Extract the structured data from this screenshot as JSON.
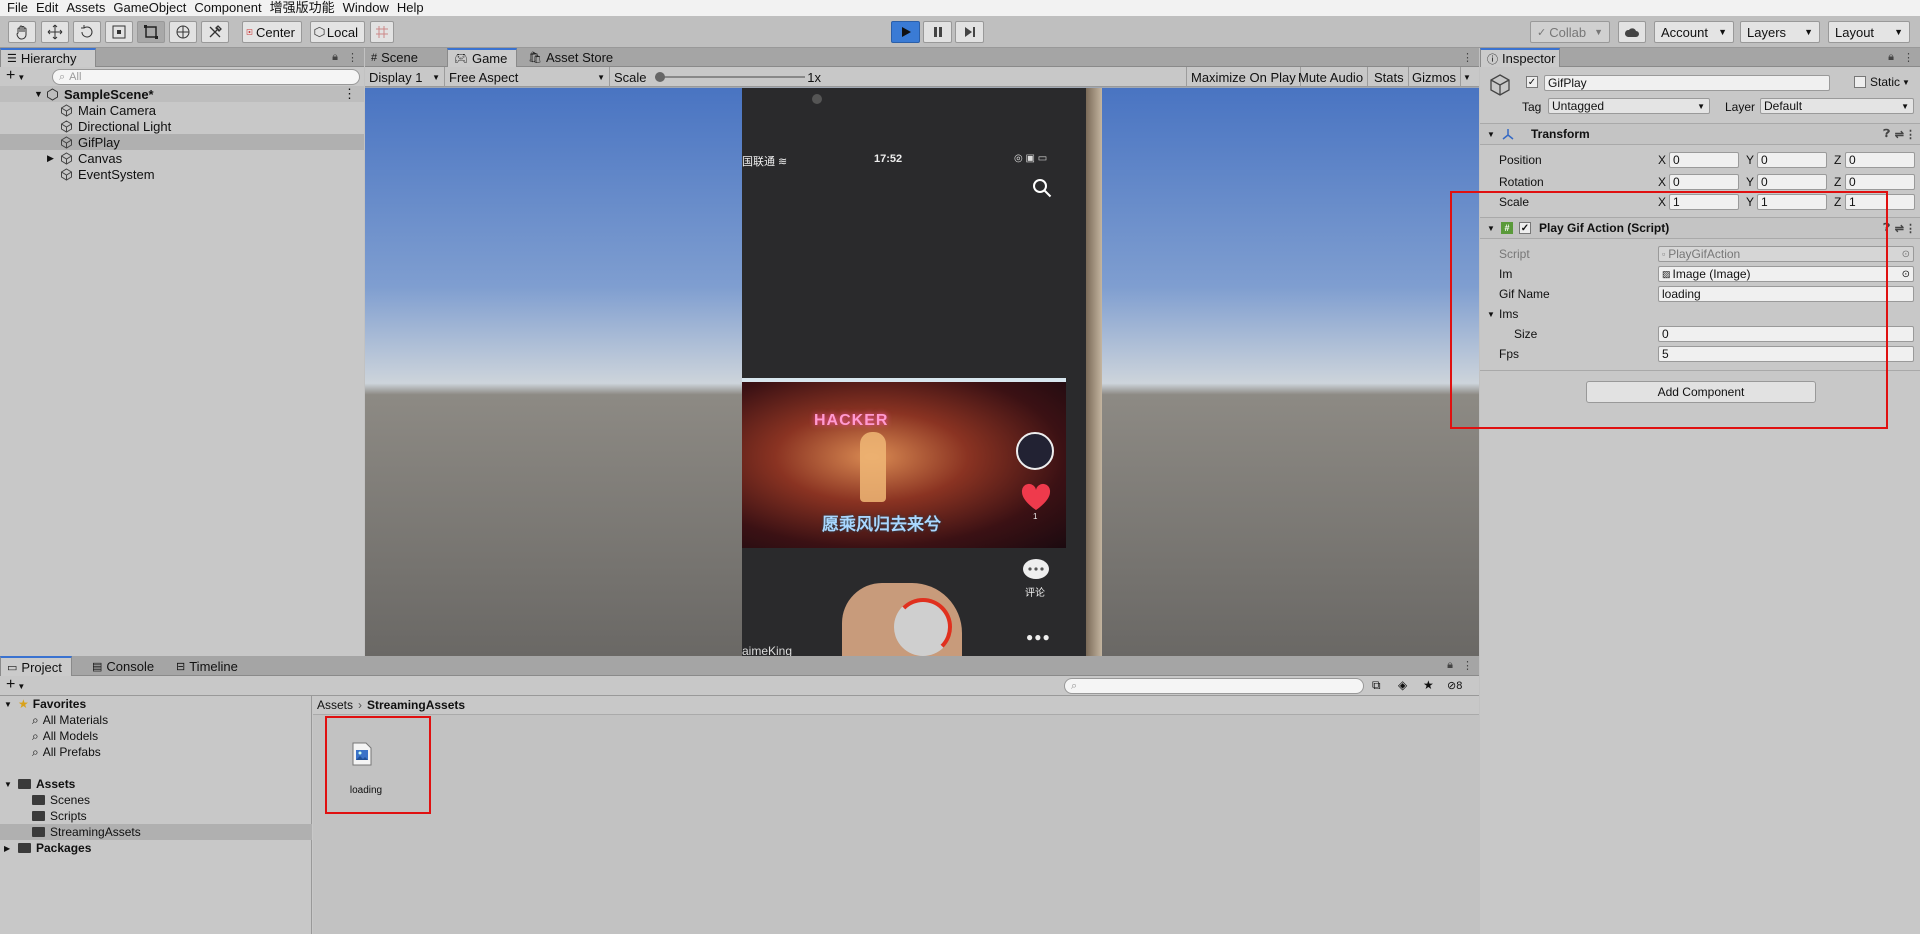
{
  "menu": [
    "File",
    "Edit",
    "Assets",
    "GameObject",
    "Component",
    "增强版功能",
    "Window",
    "Help"
  ],
  "toolbar": {
    "pivot_label": "Center",
    "space_label": "Local",
    "collab_label": "Collab",
    "account_label": "Account",
    "layers_label": "Layers",
    "layout_label": "Layout"
  },
  "hierarchy": {
    "tab": "Hierarchy",
    "search_placeholder": "All",
    "scene": "SampleScene*",
    "items": [
      "Main Camera",
      "Directional Light",
      "GifPlay",
      "Canvas",
      "EventSystem"
    ],
    "selected": "GifPlay"
  },
  "game": {
    "tabs": [
      "Scene",
      "Game",
      "Asset Store"
    ],
    "active_tab": "Game",
    "display": "Display 1",
    "aspect": "Free Aspect",
    "scale_label": "Scale",
    "scale_value": "1x",
    "toggles": [
      "Maximize On Play",
      "Mute Audio",
      "Stats",
      "Gizmos"
    ],
    "phone": {
      "carrier": "国联通",
      "time": "17:52",
      "video_caption": "愿乘风归去来兮",
      "neon_sign": "HACKER",
      "comment_label": "评论",
      "like_count": "1",
      "bottom_text": "aimeKing"
    }
  },
  "inspector": {
    "tab": "Inspector",
    "object_name": "GifPlay",
    "static_label": "Static",
    "tag_label": "Tag",
    "tag_value": "Untagged",
    "layer_label": "Layer",
    "layer_value": "Default",
    "transform": {
      "title": "Transform",
      "rows": [
        {
          "label": "Position",
          "x": "0",
          "y": "0",
          "z": "0"
        },
        {
          "label": "Rotation",
          "x": "0",
          "y": "0",
          "z": "0"
        },
        {
          "label": "Scale",
          "x": "1",
          "y": "1",
          "z": "1"
        }
      ]
    },
    "script_component": {
      "title": "Play Gif Action (Script)",
      "script_label": "Script",
      "script_value": "PlayGifAction",
      "im_label": "Im",
      "im_value": "Image (Image)",
      "gif_name_label": "Gif Name",
      "gif_name_value": "loading",
      "ims_label": "Ims",
      "size_label": "Size",
      "size_value": "0",
      "fps_label": "Fps",
      "fps_value": "5"
    },
    "add_component": "Add Component"
  },
  "project": {
    "tabs": [
      "Project",
      "Console",
      "Timeline"
    ],
    "hidden_count": "8",
    "favorites_label": "Favorites",
    "favorites": [
      "All Materials",
      "All Models",
      "All Prefabs"
    ],
    "assets_label": "Assets",
    "asset_folders": [
      "Scenes",
      "Scripts",
      "StreamingAssets"
    ],
    "packages_label": "Packages",
    "breadcrumb": [
      "Assets",
      "StreamingAssets"
    ],
    "files": [
      "loading"
    ]
  }
}
